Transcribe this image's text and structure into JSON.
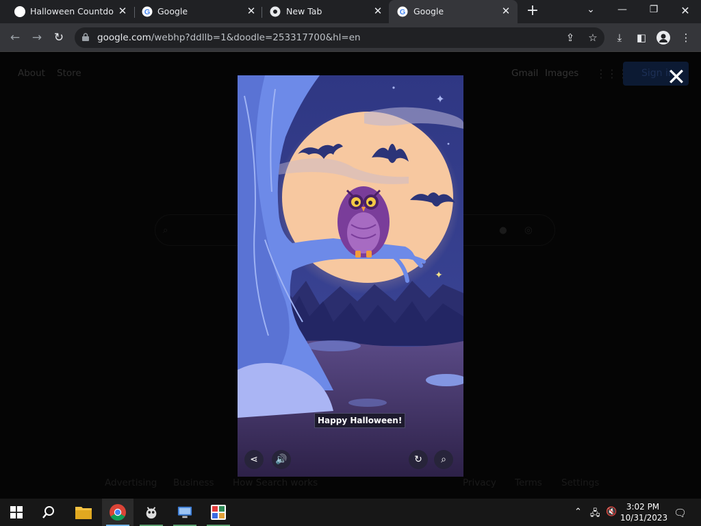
{
  "tabs": [
    {
      "title": "Halloween Countdown",
      "icon": "halloween-favicon",
      "active": false
    },
    {
      "title": "Google",
      "icon": "google-g-icon",
      "active": false
    },
    {
      "title": "New Tab",
      "icon": "chrome-icon",
      "active": false
    },
    {
      "title": "Google",
      "icon": "google-g-icon",
      "active": true
    }
  ],
  "address": {
    "host": "google.com",
    "path": "/webhp?ddllb=1&doodle=253317700&hl=en"
  },
  "page": {
    "about": "About",
    "store": "Store",
    "gmail": "Gmail",
    "images": "Images",
    "signin": "Sign in",
    "footer_left": [
      "Advertising",
      "Business",
      "How Search works"
    ],
    "footer_right": [
      "Privacy",
      "Terms",
      "Settings"
    ]
  },
  "doodle": {
    "greeting": "Happy Halloween!",
    "buttons": [
      "share",
      "sound",
      "replay",
      "search"
    ]
  },
  "clock": {
    "time": "3:02 PM",
    "date": "10/31/2023"
  },
  "colors": {
    "sky": "#3b3f8e",
    "moon": "#f7c8a0",
    "tree": "#6d8ae8",
    "owl": "#7a3d9a",
    "ground": "#4a3a6e"
  }
}
